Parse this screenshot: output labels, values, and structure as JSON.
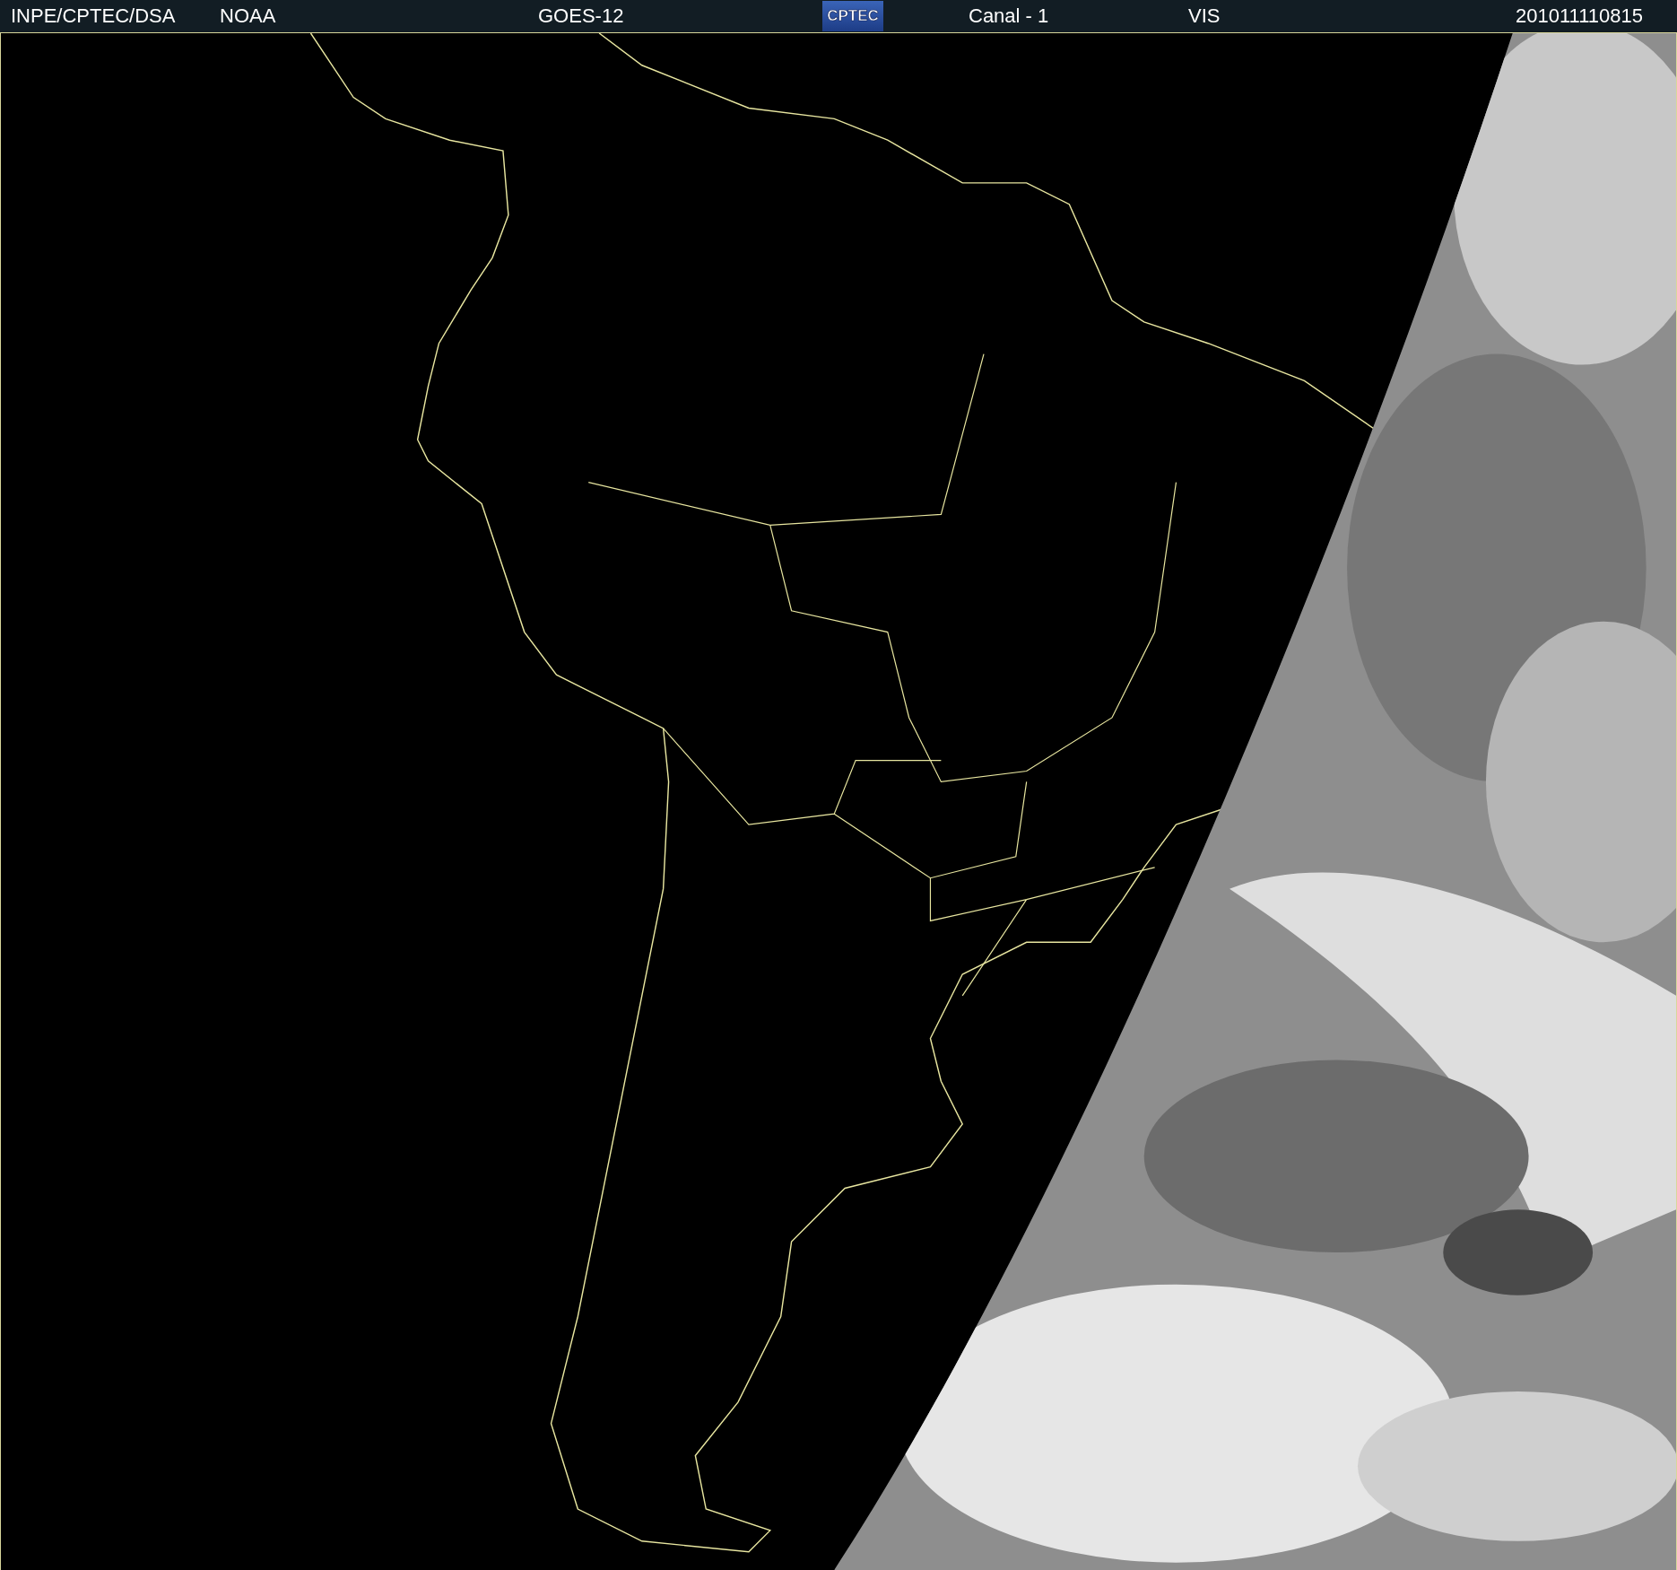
{
  "header": [
    {
      "kind": "text",
      "text": "INPE/CPTEC/DSA"
    },
    {
      "kind": "text",
      "text": "NOAA"
    },
    {
      "kind": "text",
      "text": "GOES-12"
    },
    {
      "kind": "logo",
      "text": "CPTEC"
    },
    {
      "kind": "text",
      "text": "Canal - 1"
    },
    {
      "kind": "text",
      "text": "VIS"
    },
    {
      "kind": "text",
      "text": "201011110815"
    }
  ]
}
